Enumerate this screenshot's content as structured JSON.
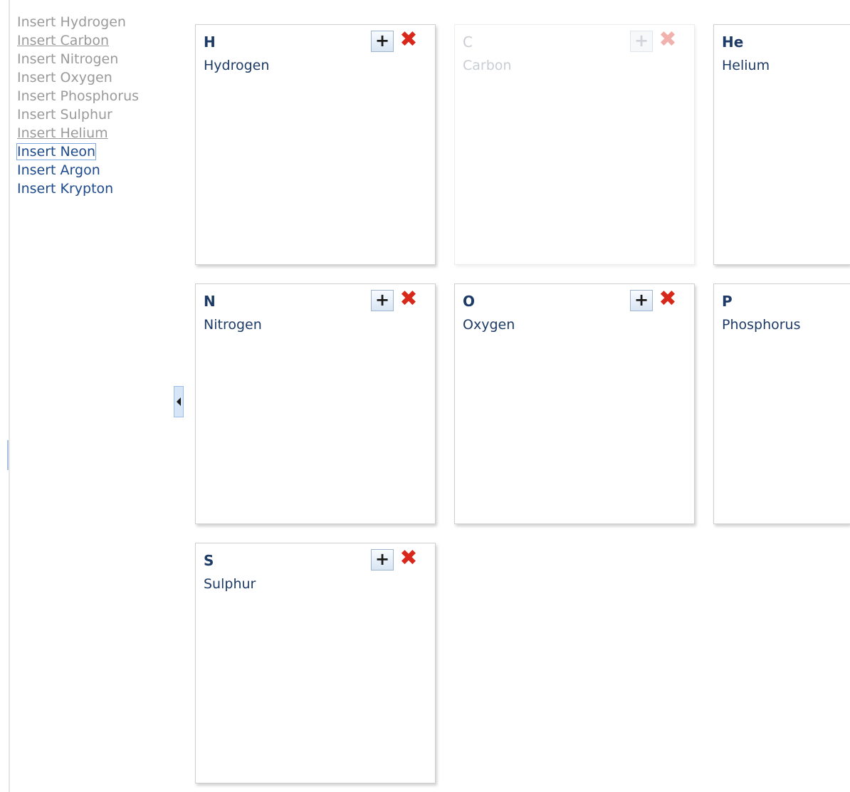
{
  "sidebar": {
    "links": [
      {
        "label": "Insert Hydrogen",
        "state": "disabled"
      },
      {
        "label": "Insert Carbon",
        "state": "disabled-underlined"
      },
      {
        "label": "Insert Nitrogen",
        "state": "disabled"
      },
      {
        "label": "Insert Oxygen",
        "state": "disabled"
      },
      {
        "label": "Insert Phosphorus",
        "state": "disabled"
      },
      {
        "label": "Insert Sulphur",
        "state": "disabled"
      },
      {
        "label": "Insert Helium",
        "state": "disabled-underlined"
      },
      {
        "label": "Insert Neon",
        "state": "active-focused"
      },
      {
        "label": "Insert Argon",
        "state": "active"
      },
      {
        "label": "Insert Krypton",
        "state": "active"
      }
    ]
  },
  "cards": [
    {
      "symbol": "H",
      "name": "Hydrogen",
      "add_label": "+",
      "remove_label": "✖",
      "dimmed": false
    },
    {
      "symbol": "C",
      "name": "Carbon",
      "add_label": "+",
      "remove_label": "✖",
      "dimmed": true
    },
    {
      "symbol": "He",
      "name": "Helium",
      "add_label": "+",
      "remove_label": "✖",
      "dimmed": false
    },
    {
      "symbol": "N",
      "name": "Nitrogen",
      "add_label": "+",
      "remove_label": "✖",
      "dimmed": false
    },
    {
      "symbol": "O",
      "name": "Oxygen",
      "add_label": "+",
      "remove_label": "✖",
      "dimmed": false
    },
    {
      "symbol": "P",
      "name": "Phosphorus",
      "add_label": "+",
      "remove_label": "✖",
      "dimmed": false
    },
    {
      "symbol": "S",
      "name": "Sulphur",
      "add_label": "+",
      "remove_label": "✖",
      "dimmed": false
    }
  ],
  "colors": {
    "text_active": "#1d4a8c",
    "text_disabled": "#9a9a9a",
    "card_text": "#1d3b66",
    "remove_red": "#d8281b"
  },
  "icons": {
    "collapse": "triangle-left-icon",
    "add": "plus-icon",
    "remove": "red-x-icon"
  }
}
